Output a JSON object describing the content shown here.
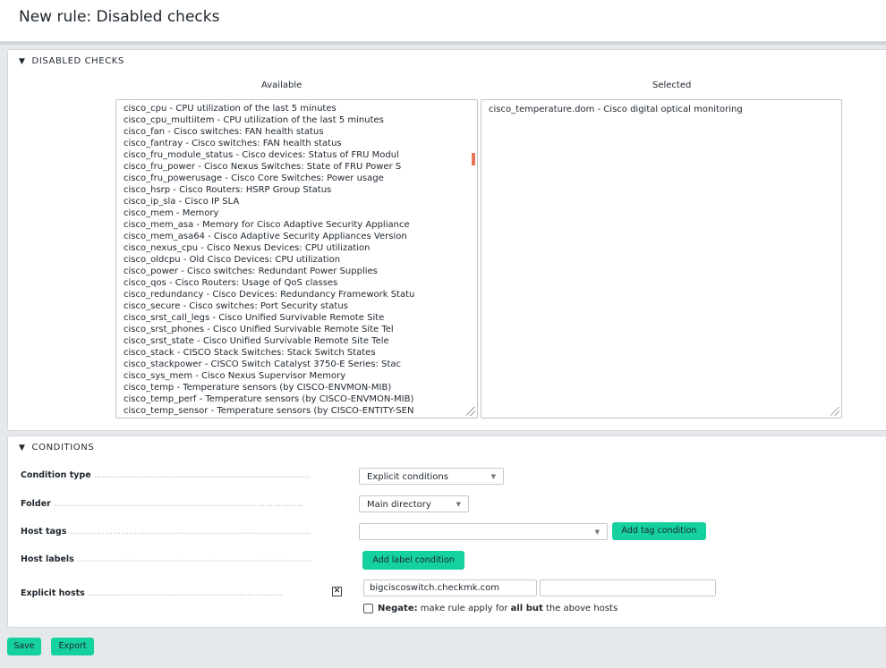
{
  "page": {
    "title": "New rule: Disabled checks"
  },
  "disabled_checks": {
    "header": "DISABLED CHECKS",
    "available_label": "Available",
    "selected_label": "Selected",
    "move_right_label": ">",
    "move_left_label": "<",
    "available": [
      "cisco_cpu - CPU utilization of the last 5 minutes",
      "cisco_cpu_multiitem - CPU utilization of the last 5 minutes",
      "cisco_fan - Cisco switches: FAN health status",
      "cisco_fantray - Cisco switches: FAN health status",
      "cisco_fru_module_status - Cisco devices: Status of FRU Modul",
      "cisco_fru_power - Cisco Nexus Switches: State of FRU Power S",
      "cisco_fru_powerusage - Cisco Core Switches: Power usage",
      "cisco_hsrp - Cisco Routers: HSRP Group Status",
      "cisco_ip_sla - Cisco IP SLA",
      "cisco_mem - Memory",
      "cisco_mem_asa - Memory for Cisco Adaptive Security Appliance",
      "cisco_mem_asa64 - Cisco Adaptive Security Appliances Version",
      "cisco_nexus_cpu - Cisco Nexus Devices: CPU utilization",
      "cisco_oldcpu - Old Cisco Devices: CPU utilization",
      "cisco_power - Cisco switches: Redundant Power Supplies",
      "cisco_qos - Cisco Routers: Usage of QoS classes",
      "cisco_redundancy - Cisco Devices: Redundancy Framework Statu",
      "cisco_secure - Cisco switches: Port Security status",
      "cisco_srst_call_legs - Cisco Unified Survivable Remote Site",
      "cisco_srst_phones - Cisco Unified Survivable Remote Site Tel",
      "cisco_srst_state - Cisco Unified Survivable Remote Site Tele",
      "cisco_stack - CISCO Stack Switches: Stack Switch States",
      "cisco_stackpower - CISCO Switch Catalyst 3750-E Series: Stac",
      "cisco_sys_mem - Cisco Nexus Supervisor Memory",
      "cisco_temp - Temperature sensors (by CISCO-ENVMON-MIB)",
      "cisco_temp_perf - Temperature sensors (by CISCO-ENVMON-MIB)",
      "cisco_temp_sensor - Temperature sensors (by CISCO-ENTITY-SEN"
    ],
    "selected": [
      "cisco_temperature.dom - Cisco digital optical monitoring"
    ]
  },
  "conditions": {
    "header": "CONDITIONS",
    "condition_type_label": "Condition type",
    "condition_type_value": "Explicit conditions",
    "folder_label": "Folder",
    "folder_value": "Main directory",
    "host_tags_label": "Host tags",
    "host_tags_value": "",
    "add_tag_label": "Add tag condition",
    "host_labels_label": "Host labels",
    "add_label_label": "Add label condition",
    "explicit_hosts_label": "Explicit hosts",
    "explicit_host_1": "bigciscoswitch.checkmk.com",
    "explicit_host_2": "",
    "negate_bold": "Negate:",
    "negate_text_1": " make rule apply for ",
    "negate_text_bold": "all but",
    "negate_text_2": " the above hosts"
  },
  "footer": {
    "save_label": "Save",
    "export_label": "Export"
  },
  "colors": {
    "accent": "#15d1a0",
    "scroll_marker": "#e8755a"
  }
}
